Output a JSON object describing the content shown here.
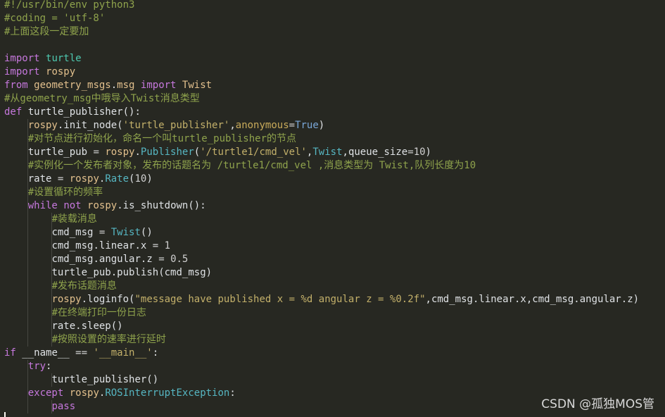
{
  "editor": {
    "lines": [
      {
        "tokens": [
          {
            "t": "#!/usr/bin/env python3",
            "c": "c-comment"
          }
        ]
      },
      {
        "tokens": [
          {
            "t": "#coding = 'utf-8'",
            "c": "c-comment"
          }
        ]
      },
      {
        "tokens": [
          {
            "t": "#上面这段一定要加",
            "c": "c-comment"
          }
        ]
      },
      {
        "tokens": [
          {
            "t": "",
            "c": "c-plain"
          }
        ]
      },
      {
        "tokens": [
          {
            "t": "import",
            "c": "c-kw"
          },
          {
            "t": " ",
            "c": "c-plain"
          },
          {
            "t": "turtle",
            "c": "c-mod"
          }
        ]
      },
      {
        "tokens": [
          {
            "t": "import",
            "c": "c-kw"
          },
          {
            "t": " ",
            "c": "c-plain"
          },
          {
            "t": "rospy",
            "c": "c-name"
          }
        ]
      },
      {
        "tokens": [
          {
            "t": "from",
            "c": "c-kw"
          },
          {
            "t": " ",
            "c": "c-plain"
          },
          {
            "t": "geometry_msgs",
            "c": "c-name"
          },
          {
            "t": ".",
            "c": "c-plain"
          },
          {
            "t": "msg",
            "c": "c-name"
          },
          {
            "t": " ",
            "c": "c-plain"
          },
          {
            "t": "import",
            "c": "c-kw"
          },
          {
            "t": " ",
            "c": "c-plain"
          },
          {
            "t": "Twist",
            "c": "c-name"
          }
        ]
      },
      {
        "tokens": [
          {
            "t": "#从geometry_msg中哦导入Twist消息类型",
            "c": "c-comment"
          }
        ]
      },
      {
        "tokens": [
          {
            "t": "def",
            "c": "c-kw"
          },
          {
            "t": " ",
            "c": "c-plain"
          },
          {
            "t": "turtle_publisher",
            "c": "c-plain"
          },
          {
            "t": "():",
            "c": "c-plain"
          }
        ]
      },
      {
        "indent": 1,
        "tokens": [
          {
            "t": "    ",
            "c": "c-plain"
          },
          {
            "t": "rospy",
            "c": "c-name"
          },
          {
            "t": ".",
            "c": "c-plain"
          },
          {
            "t": "init_node",
            "c": "c-plain"
          },
          {
            "t": "(",
            "c": "c-plain"
          },
          {
            "t": "'turtle_publisher'",
            "c": "c-str"
          },
          {
            "t": ",",
            "c": "c-plain"
          },
          {
            "t": "anonymous",
            "c": "c-attr"
          },
          {
            "t": "=",
            "c": "c-op"
          },
          {
            "t": "True",
            "c": "c-builtin"
          },
          {
            "t": ")",
            "c": "c-plain"
          }
        ]
      },
      {
        "indent": 1,
        "tokens": [
          {
            "t": "    ",
            "c": "c-plain"
          },
          {
            "t": "#对节点进行初始化，命名一个叫turtle_publisher的节点",
            "c": "c-comment"
          }
        ]
      },
      {
        "indent": 1,
        "tokens": [
          {
            "t": "    ",
            "c": "c-plain"
          },
          {
            "t": "turtle_pub",
            "c": "c-plain"
          },
          {
            "t": " = ",
            "c": "c-op"
          },
          {
            "t": "rospy",
            "c": "c-name"
          },
          {
            "t": ".",
            "c": "c-plain"
          },
          {
            "t": "Publisher",
            "c": "c-class"
          },
          {
            "t": "(",
            "c": "c-plain"
          },
          {
            "t": "'/turtle1/cmd_vel'",
            "c": "c-str"
          },
          {
            "t": ",",
            "c": "c-plain"
          },
          {
            "t": "Twist",
            "c": "c-class"
          },
          {
            "t": ",",
            "c": "c-plain"
          },
          {
            "t": "queue_size",
            "c": "c-plain"
          },
          {
            "t": "=",
            "c": "c-op"
          },
          {
            "t": "10",
            "c": "c-num"
          },
          {
            "t": ")",
            "c": "c-plain"
          }
        ]
      },
      {
        "indent": 1,
        "tokens": [
          {
            "t": "    ",
            "c": "c-plain"
          },
          {
            "t": "#实例化一个发布者对象，发布的话题名为 /turtle1/cmd_vel ,消息类型为 Twist,队列长度为10",
            "c": "c-comment"
          }
        ]
      },
      {
        "indent": 1,
        "tokens": [
          {
            "t": "    ",
            "c": "c-plain"
          },
          {
            "t": "rate",
            "c": "c-plain"
          },
          {
            "t": " = ",
            "c": "c-op"
          },
          {
            "t": "rospy",
            "c": "c-name"
          },
          {
            "t": ".",
            "c": "c-plain"
          },
          {
            "t": "Rate",
            "c": "c-class"
          },
          {
            "t": "(",
            "c": "c-plain"
          },
          {
            "t": "10",
            "c": "c-num"
          },
          {
            "t": ")",
            "c": "c-plain"
          }
        ]
      },
      {
        "indent": 1,
        "tokens": [
          {
            "t": "    ",
            "c": "c-plain"
          },
          {
            "t": "#设置循环的频率",
            "c": "c-comment"
          }
        ]
      },
      {
        "indent": 1,
        "tokens": [
          {
            "t": "    ",
            "c": "c-plain"
          },
          {
            "t": "while",
            "c": "c-kw"
          },
          {
            "t": " ",
            "c": "c-plain"
          },
          {
            "t": "not",
            "c": "c-kw"
          },
          {
            "t": " ",
            "c": "c-plain"
          },
          {
            "t": "rospy",
            "c": "c-name"
          },
          {
            "t": ".",
            "c": "c-plain"
          },
          {
            "t": "is_shutdown",
            "c": "c-plain"
          },
          {
            "t": "():",
            "c": "c-plain"
          }
        ]
      },
      {
        "indent": 2,
        "tokens": [
          {
            "t": "        ",
            "c": "c-plain"
          },
          {
            "t": "#装载消息",
            "c": "c-comment"
          }
        ]
      },
      {
        "indent": 2,
        "tokens": [
          {
            "t": "        ",
            "c": "c-plain"
          },
          {
            "t": "cmd_msg",
            "c": "c-plain"
          },
          {
            "t": " = ",
            "c": "c-op"
          },
          {
            "t": "Twist",
            "c": "c-class"
          },
          {
            "t": "()",
            "c": "c-plain"
          }
        ]
      },
      {
        "indent": 2,
        "tokens": [
          {
            "t": "        ",
            "c": "c-plain"
          },
          {
            "t": "cmd_msg",
            "c": "c-plain"
          },
          {
            "t": ".",
            "c": "c-plain"
          },
          {
            "t": "linear",
            "c": "c-plain"
          },
          {
            "t": ".",
            "c": "c-plain"
          },
          {
            "t": "x",
            "c": "c-plain"
          },
          {
            "t": " = ",
            "c": "c-op"
          },
          {
            "t": "1",
            "c": "c-num"
          }
        ]
      },
      {
        "indent": 2,
        "tokens": [
          {
            "t": "        ",
            "c": "c-plain"
          },
          {
            "t": "cmd_msg",
            "c": "c-plain"
          },
          {
            "t": ".",
            "c": "c-plain"
          },
          {
            "t": "angular",
            "c": "c-plain"
          },
          {
            "t": ".",
            "c": "c-plain"
          },
          {
            "t": "z",
            "c": "c-plain"
          },
          {
            "t": " = ",
            "c": "c-op"
          },
          {
            "t": "0.5",
            "c": "c-num"
          }
        ]
      },
      {
        "indent": 2,
        "tokens": [
          {
            "t": "        ",
            "c": "c-plain"
          },
          {
            "t": "turtle_pub",
            "c": "c-plain"
          },
          {
            "t": ".",
            "c": "c-plain"
          },
          {
            "t": "publish",
            "c": "c-plain"
          },
          {
            "t": "(",
            "c": "c-plain"
          },
          {
            "t": "cmd_msg",
            "c": "c-plain"
          },
          {
            "t": ")",
            "c": "c-plain"
          }
        ]
      },
      {
        "indent": 2,
        "tokens": [
          {
            "t": "        ",
            "c": "c-plain"
          },
          {
            "t": "#发布话题消息",
            "c": "c-comment"
          }
        ]
      },
      {
        "indent": 2,
        "tokens": [
          {
            "t": "        ",
            "c": "c-plain"
          },
          {
            "t": "rospy",
            "c": "c-name"
          },
          {
            "t": ".",
            "c": "c-plain"
          },
          {
            "t": "loginfo",
            "c": "c-plain"
          },
          {
            "t": "(",
            "c": "c-plain"
          },
          {
            "t": "\"message have published x = %d angular z = %0.2f\"",
            "c": "c-str"
          },
          {
            "t": ",",
            "c": "c-plain"
          },
          {
            "t": "cmd_msg",
            "c": "c-plain"
          },
          {
            "t": ".",
            "c": "c-plain"
          },
          {
            "t": "linear",
            "c": "c-plain"
          },
          {
            "t": ".",
            "c": "c-plain"
          },
          {
            "t": "x",
            "c": "c-plain"
          },
          {
            "t": ",",
            "c": "c-plain"
          },
          {
            "t": "cmd_msg",
            "c": "c-plain"
          },
          {
            "t": ".",
            "c": "c-plain"
          },
          {
            "t": "angular",
            "c": "c-plain"
          },
          {
            "t": ".",
            "c": "c-plain"
          },
          {
            "t": "z",
            "c": "c-plain"
          },
          {
            "t": ")",
            "c": "c-plain"
          }
        ]
      },
      {
        "indent": 2,
        "tokens": [
          {
            "t": "        ",
            "c": "c-plain"
          },
          {
            "t": "#在终端打印一份日志",
            "c": "c-comment"
          }
        ]
      },
      {
        "indent": 2,
        "tokens": [
          {
            "t": "        ",
            "c": "c-plain"
          },
          {
            "t": "rate",
            "c": "c-plain"
          },
          {
            "t": ".",
            "c": "c-plain"
          },
          {
            "t": "sleep",
            "c": "c-plain"
          },
          {
            "t": "()",
            "c": "c-plain"
          }
        ]
      },
      {
        "indent": 2,
        "tokens": [
          {
            "t": "        ",
            "c": "c-plain"
          },
          {
            "t": "#按照设置的速率进行延时",
            "c": "c-comment"
          }
        ]
      },
      {
        "tokens": [
          {
            "t": "if",
            "c": "c-kw"
          },
          {
            "t": " ",
            "c": "c-plain"
          },
          {
            "t": "__name__",
            "c": "c-plain"
          },
          {
            "t": " == ",
            "c": "c-op"
          },
          {
            "t": "'__main__'",
            "c": "c-str"
          },
          {
            "t": ":",
            "c": "c-plain"
          }
        ]
      },
      {
        "indent": 1,
        "tokens": [
          {
            "t": "    ",
            "c": "c-plain"
          },
          {
            "t": "try",
            "c": "c-kw"
          },
          {
            "t": ":",
            "c": "c-plain"
          }
        ]
      },
      {
        "indent": 2,
        "tokens": [
          {
            "t": "        ",
            "c": "c-plain"
          },
          {
            "t": "turtle_publisher",
            "c": "c-plain"
          },
          {
            "t": "()",
            "c": "c-plain"
          }
        ]
      },
      {
        "indent": 1,
        "tokens": [
          {
            "t": "    ",
            "c": "c-plain"
          },
          {
            "t": "except",
            "c": "c-kw"
          },
          {
            "t": " ",
            "c": "c-plain"
          },
          {
            "t": "rospy",
            "c": "c-name"
          },
          {
            "t": ".",
            "c": "c-plain"
          },
          {
            "t": "ROSInterruptException",
            "c": "c-class"
          },
          {
            "t": ":",
            "c": "c-plain"
          }
        ]
      },
      {
        "indent": 2,
        "tokens": [
          {
            "t": "        ",
            "c": "c-plain"
          },
          {
            "t": "pass",
            "c": "c-kw"
          }
        ]
      }
    ]
  },
  "watermark": "CSDN @孤独MOS管",
  "colors": {
    "background": "#272822",
    "comment": "#8fa34c",
    "keyword": "#c678dd",
    "string": "#c3b06a"
  }
}
